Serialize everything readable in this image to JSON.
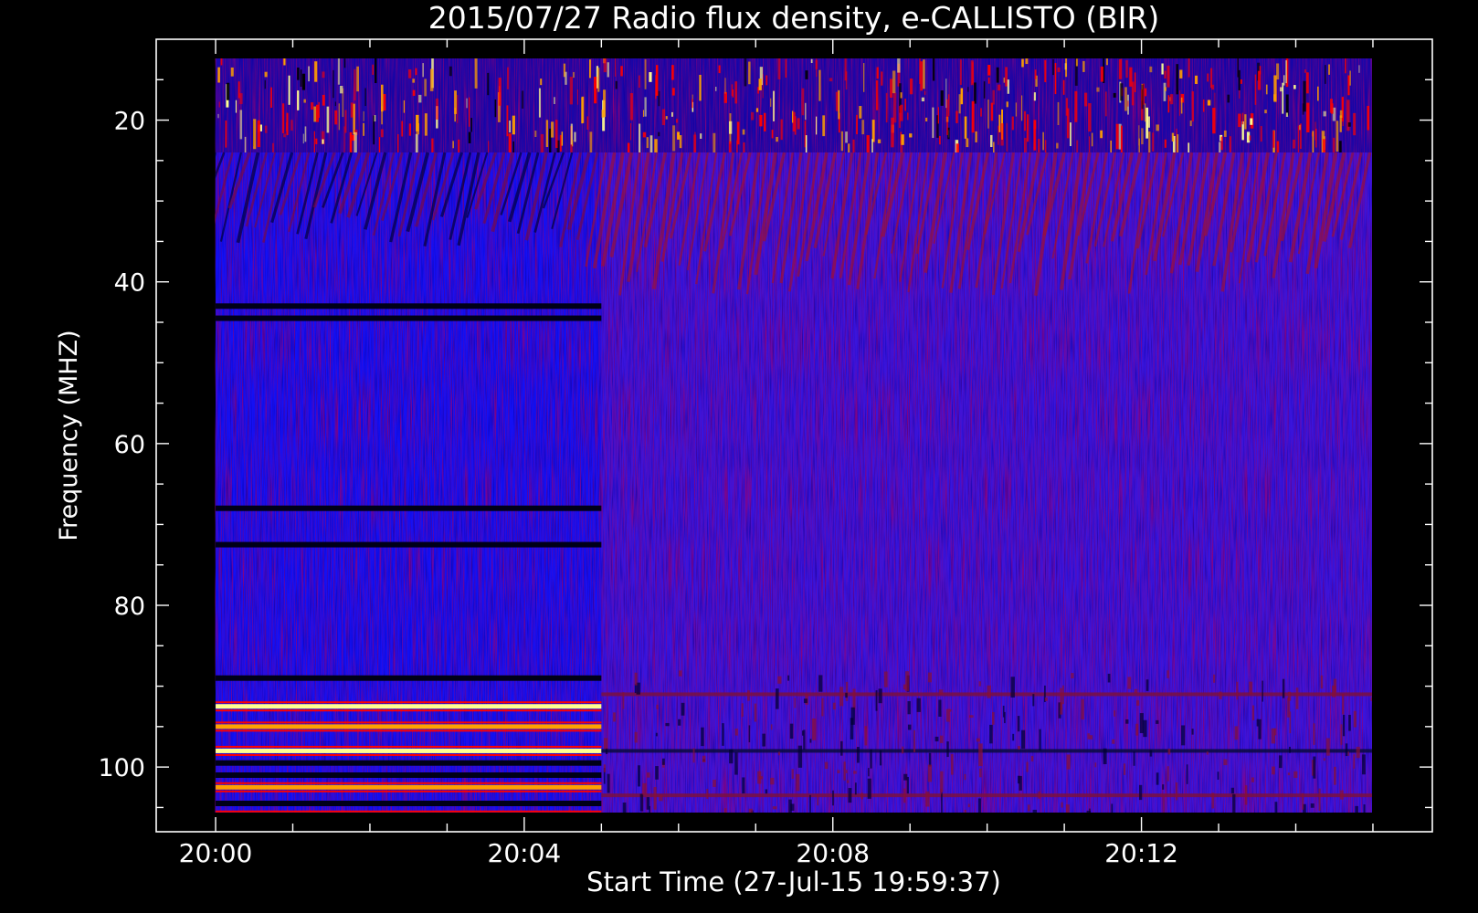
{
  "chart_data": {
    "type": "heatmap",
    "title": "2015/07/27  Radio flux density, e-CALLISTO (BIR)",
    "xlabel": "Start Time (27-Jul-15 19:59:37)",
    "ylabel": "Frequency (MHZ)",
    "x_tick_labels": [
      "20:00",
      "20:04",
      "20:08",
      "20:12"
    ],
    "x_tick_minutes": [
      0,
      4,
      8,
      12
    ],
    "y_ticks": [
      20,
      40,
      60,
      80,
      100
    ],
    "y_tick_labels": [
      "20",
      "40",
      "60",
      "80",
      "100"
    ],
    "y_axis_inverted": true,
    "xlim_minutes_after_2000": [
      -0.77,
      15.77
    ],
    "ylim_mhz": [
      10,
      108
    ],
    "data_time_range_minutes": [
      0,
      15
    ],
    "data_freq_range_mhz": [
      12,
      107
    ],
    "regime_change_minute": 5.0,
    "colormap": [
      "#000000",
      "#0000ff",
      "#ff0000",
      "#ffa000",
      "#ffff90"
    ],
    "axis_color": "#ffffff",
    "background_color": "#000000",
    "features": {
      "rfi_top_band_mhz": [
        12,
        24
      ],
      "drifting_bursts_band_mhz": [
        24,
        42
      ],
      "first_segment_horizontal_lines_mhz": [
        43,
        44.5,
        68,
        72.5,
        89,
        92.5,
        95,
        98,
        99.5,
        101,
        102.5,
        104.5,
        106
      ],
      "second_segment_horizontal_lines_mhz": [
        91,
        98,
        103.5
      ]
    }
  }
}
